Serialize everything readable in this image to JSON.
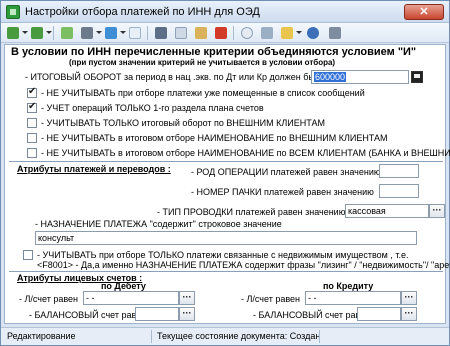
{
  "window": {
    "title": "Настройки  отбора платежей по ИНН для ОЭД",
    "close_label": "✕"
  },
  "toolbar": {
    "icons": [
      "back-icon",
      "forward-icon",
      "new-doc-icon",
      "print-icon",
      "export-icon",
      "doc-icon",
      "cut-icon",
      "copy-icon",
      "paste-icon",
      "delete-icon",
      "clock-icon",
      "link-icon",
      "mail-icon",
      "info-icon",
      "exit-icon"
    ]
  },
  "header": {
    "title": "В условии  по ИНН перечисленные  критерии   объединяются условием \"И\"",
    "subtitle": "(при пустом значении критерий не учитывается в условии отбора)"
  },
  "turnover": {
    "label": "- ИТОГОВЫЙ ОБОРОТ за период в нац .экв. по Дт или Кр  должен быть  >=",
    "value": "600000"
  },
  "options": [
    {
      "label": "- НЕ УЧИТЫВАТЬ при отборе платежи уже помещенные в список сообщений",
      "checked": true
    },
    {
      "label": "- УЧЕТ операций ТОЛЬКО 1-го раздела плана счетов",
      "checked": true
    },
    {
      "label": "- УЧИТЫВАТЬ ТОЛЬКО итоговый оборот по ВНЕШНИМ КЛИЕНТАМ",
      "checked": false
    },
    {
      "label": "- НЕ УЧИТЫВАТЬ в итоговом отборе НАИМЕНОВАНИЕ по ВНЕШНИМ КЛИЕНТАМ",
      "checked": false
    },
    {
      "label": "- НЕ УЧИТЫВАТЬ в итоговом отборе НАИМЕНОВАНИЕ по ВСЕМ КЛИЕНТАМ (БАНКА и ВНЕШНИМ)",
      "checked": false
    }
  ],
  "attributes": {
    "title": "Атрибуты платежей и переводов  :",
    "op_code_label": "- РОД ОПЕРАЦИИ  платежей равен значению",
    "op_code_value": "",
    "pack_label": "- НОМЕР ПАЧКИ платежей равен значению",
    "pack_value": "",
    "posting_type_label": "- ТИП ПРОВОДКИ  платежей равен значению",
    "posting_type_value": "кассовая проводка",
    "purpose_label": "- НАЗНАЧЕНИЕ ПЛАТЕЖА  \"содержит\"  строковое значение",
    "purpose_value": "консульт"
  },
  "realty": {
    "line1": "-  УЧИТЫВАТЬ при отборе ТОЛЬКО платежи связанные  с недвижимым имуществом , т.е.",
    "line2": "<F8001> - Да,а именно НАЗНАЧЕНИЕ ПЛАТЕЖА содержит фразы \"лизинг\" / \"недвижимость\"/ \"аренд\"",
    "checked": false
  },
  "accounts": {
    "title": "Атрибуты лицевых счетов   :",
    "debit_header": "по Дебету",
    "credit_header": "по Кредиту",
    "debit_account_label": "- Л/счет равен",
    "debit_account_value": "-   -",
    "debit_balance_label": "- БАЛАНСОВЫЙ счет равен",
    "debit_balance_value": "",
    "credit_account_label": "- Л/счет равен",
    "credit_account_value": "-   -",
    "credit_balance_label": "- БАЛАНСОВЫЙ счет равен",
    "credit_balance_value": ""
  },
  "status": {
    "mode": "Редактирование",
    "doc_state": "Текущее состояние документа: Создан"
  }
}
